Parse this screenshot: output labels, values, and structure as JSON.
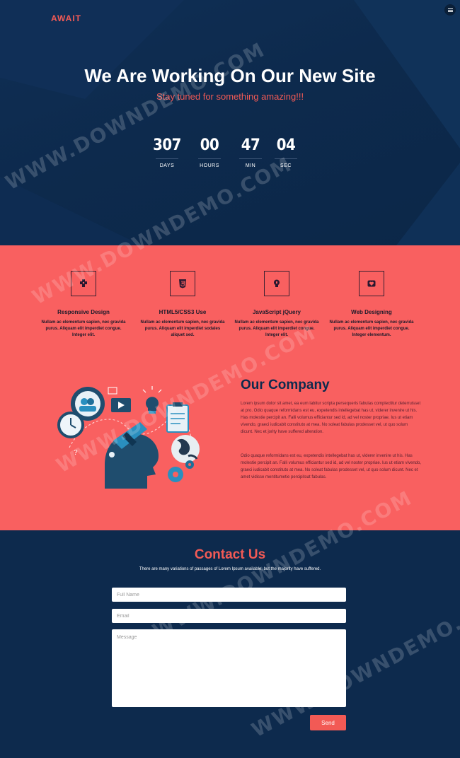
{
  "header": {
    "logo": "AWAIT",
    "menu_icon": "hamburger-menu-icon"
  },
  "hero": {
    "title": "We Are Working On Our New Site",
    "subtitle": "Stay tuned for something amazing!!!",
    "countdown": [
      {
        "value": "307",
        "label": "DAYS"
      },
      {
        "value": "00",
        "label": "HOURS"
      },
      {
        "value": "47",
        "label": "MIN"
      },
      {
        "value": "04",
        "label": "SEC"
      }
    ]
  },
  "services": [
    {
      "icon": "puzzle-icon",
      "title": "Responsive Design",
      "desc": "Nullam ac elementum sapien, nec gravida purus. Aliquam elit imperdiet congue. Integer elit."
    },
    {
      "icon": "css3-icon",
      "title": "HTML5/CSS3 Use",
      "desc": "Nullam ac elementum sapien, nec gravida purus. Aliquam elit imperdiet sodales aliquet sed."
    },
    {
      "icon": "lightbulb-icon",
      "title": "JavaScript jQuery",
      "desc": "Nullam ac elementum sapien, nec gravida purus. Aliquam elit imperdiet congue. Integer elit."
    },
    {
      "icon": "heart-icon",
      "title": "Web Designing",
      "desc": "Nullam ac elementum sapien, nec gravida purus. Aliquam elit imperdiet congue. Integer elementum."
    }
  ],
  "company": {
    "title": "Our Company",
    "p1": "Lorem ipsum dolor sit amet, ea eum labitur scripta persequeris fabulas complectitur deterruisset at pro. Odio quaque reformidans est eu, expetendis intellegebat has ut, viderer invenire ut his. Has molestie percipit an. Falli volumus efficiantur sed id, ad vel noster propriae. Ius ut etiam vivendo, graeci iudicabit constituto at mea. No soleat fabulas prodesset vel, ut quo solum dicunt. Nec et jority have suffered alteration.",
    "p2": "Odio quaque reformidans est eu, expetendis intellegebat has ut, viderer invenire ut his. Has molestie percipit an. Falli volumus efficiantur sed id, ad vel noster propriae. Ius ut etiam vivendo, graeci iudicabit constituto at mea. No soleat fabulas prodesset vel, ut quo solum dicunt. Nec et amet vidisse mentitumetie percipitoat fabulas."
  },
  "contact": {
    "title": "Contact Us",
    "subtitle": "There are many variations of passages of Lorem Ipsum available, but the majority have suffered.",
    "name_placeholder": "Full Name",
    "email_placeholder": "Email",
    "message_placeholder": "Message",
    "send_label": "Send"
  },
  "colors": {
    "navy": "#0d2a4d",
    "coral": "#f96060",
    "accent": "#f25a55"
  },
  "watermark": "WWW.DOWNDEMO.COM"
}
